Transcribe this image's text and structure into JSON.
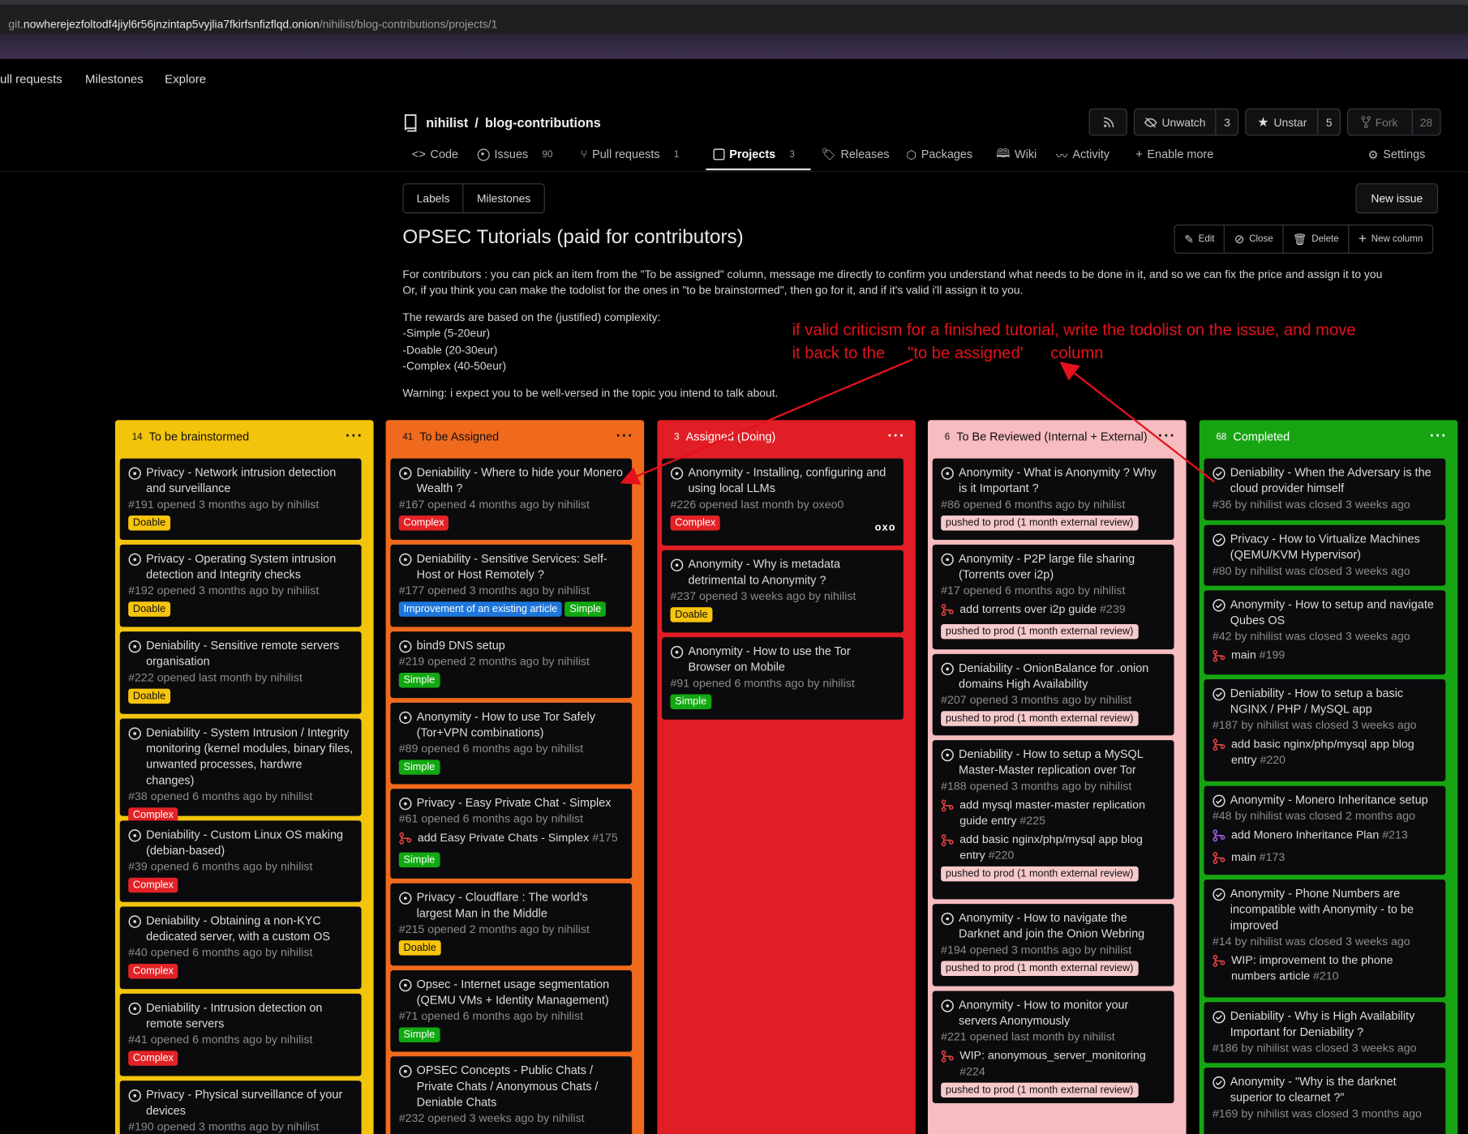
{
  "browser": {
    "url_prefix": "git.",
    "url_host": "nowherejezfoltodf4jiyl6r56jnzintap5vyjlia7fkirfsnfizflqd.onion",
    "url_path": "/nihilist/blog-contributions/projects/1"
  },
  "top_nav": {
    "pull_requests": "ull requests",
    "milestones": "Milestones",
    "explore": "Explore"
  },
  "repo": {
    "owner": "nihilist",
    "sep": "/",
    "name": "blog-contributions",
    "unwatch": "Unwatch",
    "watch_count": "3",
    "unstar": "Unstar",
    "star_count": "5",
    "fork": "Fork",
    "fork_count": "28"
  },
  "tabs": {
    "code": "Code",
    "issues": "Issues",
    "issues_count": "90",
    "pulls": "Pull requests",
    "pulls_count": "1",
    "projects": "Projects",
    "projects_count": "3",
    "releases": "Releases",
    "packages": "Packages",
    "wiki": "Wiki",
    "activity": "Activity",
    "enable_more": "Enable more",
    "settings": "Settings"
  },
  "subnav": {
    "labels": "Labels",
    "milestones": "Milestones",
    "new_issue": "New issue"
  },
  "project": {
    "title": "OPSEC Tutorials (paid for contributors)",
    "edit": "Edit",
    "close": "Close",
    "delete": "Delete",
    "new_column": "New column",
    "desc1": "For contributors : you can pick an item from the \"To be assigned\" column, message me directly to confirm you understand what needs to be done in it, and so we can fix the price and assign it to you",
    "desc2": "Or, if you think you can make the todolist for the ones in \"to be brainstormed\", then go for it, and if it's valid i'll assign it to you.",
    "desc3": "The rewards are based on the (justified) complexity:",
    "desc4": "-Simple (5-20eur)",
    "desc5": "-Doable (20-30eur)",
    "desc6": "-Complex (40-50eur)",
    "desc7": "Warning: i expect you to be well-versed in the topic you intend to talk about."
  },
  "annotation": {
    "line1": "if valid criticism for a finished tutorial, write the todolist on the issue, and move",
    "line2": "it back to the     \"to be assigned'      column"
  },
  "columns": [
    {
      "count": "14",
      "title": "To be brainstormed",
      "color": "#f2c40c"
    },
    {
      "count": "41",
      "title": "To be Assigned",
      "color": "#f06a1e"
    },
    {
      "count": "3",
      "title": "Assigned (Doing)",
      "color": "#e11d25"
    },
    {
      "count": "6",
      "title": "To Be Reviewed (Internal + External)",
      "color": "#f6bcc0"
    },
    {
      "count": "68",
      "title": "Completed",
      "color": "#17a413"
    }
  ],
  "labels": {
    "doable": "Doable",
    "complex": "Complex",
    "simple": "Simple",
    "improvement": "Improvement of an existing article",
    "pushed": "pushed to prod (1 month external review)"
  },
  "label_colors": {
    "doable": "#f7c40e",
    "complex": "#e22226",
    "simple": "#12a812",
    "improvement": "#1d76db",
    "pushed": "#f6c9cb"
  },
  "avatar_text": "oxo",
  "c1": [
    {
      "t": "Privacy - Network intrusion detection and surveillance",
      "m": "#191 opened 3 months ago by nihilist"
    },
    {
      "t": "Privacy - Operating System intrusion detection and Integrity checks",
      "m": "#192 opened 3 months ago by nihilist"
    },
    {
      "t": "Deniability - Sensitive remote servers organisation",
      "m": "#222 opened last month by nihilist"
    },
    {
      "t": "Deniability - System Intrusion / Integrity monitoring (kernel modules, binary files, unwanted processes, hardwre changes)",
      "m": "#38 opened 6 months ago by nihilist"
    },
    {
      "t": "Deniability - Custom Linux OS making (debian-based)",
      "m": "#39 opened 6 months ago by nihilist"
    },
    {
      "t": "Deniability - Obtaining a non-KYC dedicated server, with a custom OS",
      "m": "#40 opened 6 months ago by nihilist"
    },
    {
      "t": "Deniability - Intrusion detection on remote servers",
      "m": "#41 opened 6 months ago by nihilist"
    },
    {
      "t": "Privacy - Physical surveillance of your devices",
      "m": "#190 opened 3 months ago by nihilist"
    }
  ],
  "c2": [
    {
      "t": "Deniability - Where to hide your Monero Wealth ?",
      "m": "#167 opened 4 months ago by nihilist"
    },
    {
      "t": "Deniability - Sensitive Services: Self-Host or Host Remotely ?",
      "m": "#177 opened 3 months ago by nihilist"
    },
    {
      "t": "bind9 DNS setup",
      "m": "#219 opened 2 months ago by nihilist"
    },
    {
      "t": "Anonymity - How to use Tor Safely (Tor+VPN combinations)",
      "m": "#89 opened 6 months ago by nihilist"
    },
    {
      "t": "Privacy - Easy Private Chat - Simplex",
      "m": "#61 opened 6 months ago by nihilist",
      "pr": "add Easy Private Chats - Simplex",
      "prn": "#175"
    },
    {
      "t": "Privacy - Cloudflare : The world's largest Man in the Middle",
      "m": "#215 opened 2 months ago by nihilist"
    },
    {
      "t": "Opsec - Internet usage segmentation (QEMU VMs + Identity Management)",
      "m": "#71 opened 6 months ago by nihilist"
    },
    {
      "t": "OPSEC Concepts - Public Chats / Private Chats / Anonymous Chats / Deniable Chats",
      "m": "#232 opened 3 weeks ago by nihilist"
    }
  ],
  "c3": [
    {
      "t": "Anonymity - Installing, configuring and using local LLMs",
      "m": "#226 opened last month by oxeo0"
    },
    {
      "t": "Anonymity - Why is metadata detrimental to Anonymity ?",
      "m": "#237 opened 3 weeks ago by nihilist"
    },
    {
      "t": "Anonymity - How to use the Tor Browser on Mobile",
      "m": "#91 opened 6 months ago by nihilist"
    }
  ],
  "c4": [
    {
      "t": "Anonymity - What is Anonymity ? Why is it Important ?",
      "m": "#86 opened 6 months ago by nihilist"
    },
    {
      "t": "Anonymity - P2P large file sharing (Torrents over i2p)",
      "m": "#17 opened 6 months ago by nihilist",
      "pr": "add torrents over i2p guide",
      "prn": "#239"
    },
    {
      "t": "Deniability - OnionBalance for .onion domains High Availability",
      "m": "#207 opened 3 months ago by nihilist"
    },
    {
      "t": "Deniability - How to setup a MySQL Master-Master replication over Tor",
      "m": "#188 opened 3 months ago by nihilist",
      "pr": "add mysql master-master replication guide entry",
      "prn": "#225",
      "pr2": "add basic nginx/php/mysql app blog entry",
      "pr2n": "#220"
    },
    {
      "t": "Anonymity - How to navigate the Darknet and join the Onion Webring",
      "m": "#194 opened 3 months ago by nihilist"
    },
    {
      "t": "Anonymity - How to monitor your servers Anonymously",
      "m": "#221 opened last month by nihilist",
      "pr": "WIP: anonymous_server_monitoring",
      "prn": "#224"
    }
  ],
  "c5": [
    {
      "t": "Deniability - When the Adversary is the cloud provider himself",
      "m": "#36 by nihilist was closed 3 weeks ago"
    },
    {
      "t": "Privacy - How to Virtualize Machines (QEMU/KVM Hypervisor)",
      "m": "#80 by nihilist was closed 3 weeks ago"
    },
    {
      "t": "Anonymity - How to setup and navigate Qubes OS",
      "m": "#42 by nihilist was closed 3 weeks ago",
      "pr": "main",
      "prn": "#199"
    },
    {
      "t": "Deniability - How to setup a basic NGINX / PHP / MySQL app",
      "m": "#187 by nihilist was closed 3 weeks ago",
      "pr": "add basic nginx/php/mysql app blog entry",
      "prn": "#220"
    },
    {
      "t": "Anonymity - Monero Inheritance setup",
      "m": "#48 by nihilist was closed 2 months ago",
      "pr": "add Monero Inheritance Plan",
      "prn": "#213",
      "pr2": "main",
      "pr2n": "#173"
    },
    {
      "t": "Anonymity - Phone Numbers are incompatible with Anonymity - to be improved",
      "m": "#14 by nihilist was closed 3 weeks ago",
      "pr": "WIP: improvement to the phone numbers article",
      "prn": "#210"
    },
    {
      "t": "Deniability - Why is High Availability Important for Deniability ?",
      "m": "#186 by nihilist was closed 3 weeks ago"
    },
    {
      "t": "Anonymity - \"Why is the darknet superior to clearnet ?\"",
      "m": "#169 by nihilist was closed 3 months ago"
    }
  ]
}
